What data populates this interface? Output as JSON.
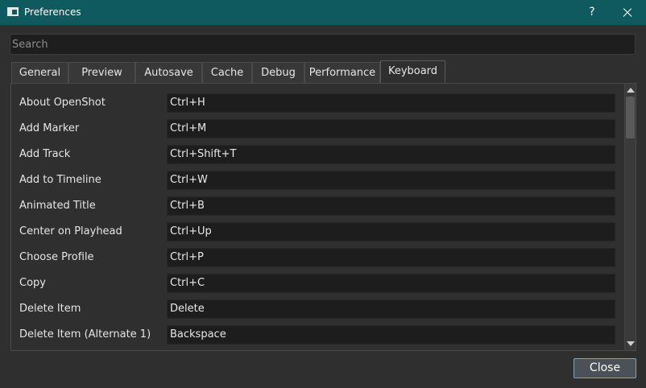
{
  "window": {
    "title": "Preferences",
    "help_label": "?"
  },
  "search": {
    "placeholder": "Search",
    "value": ""
  },
  "tabs": [
    {
      "label": "General",
      "active": false
    },
    {
      "label": "Preview",
      "active": false
    },
    {
      "label": "Autosave",
      "active": false
    },
    {
      "label": "Cache",
      "active": false
    },
    {
      "label": "Debug",
      "active": false
    },
    {
      "label": "Performance",
      "active": false
    },
    {
      "label": "Keyboard",
      "active": true
    }
  ],
  "shortcuts": [
    {
      "action": "About OpenShot",
      "keys": "Ctrl+H"
    },
    {
      "action": "Add Marker",
      "keys": "Ctrl+M"
    },
    {
      "action": "Add Track",
      "keys": "Ctrl+Shift+T"
    },
    {
      "action": "Add to Timeline",
      "keys": "Ctrl+W"
    },
    {
      "action": "Animated Title",
      "keys": "Ctrl+B"
    },
    {
      "action": "Center on Playhead",
      "keys": "Ctrl+Up"
    },
    {
      "action": "Choose Profile",
      "keys": "Ctrl+P"
    },
    {
      "action": "Copy",
      "keys": "Ctrl+C"
    },
    {
      "action": "Delete Item",
      "keys": "Delete"
    },
    {
      "action": "Delete Item (Alternate 1)",
      "keys": "Backspace"
    },
    {
      "action": "",
      "keys": ""
    }
  ],
  "footer": {
    "close_label": "Close"
  }
}
